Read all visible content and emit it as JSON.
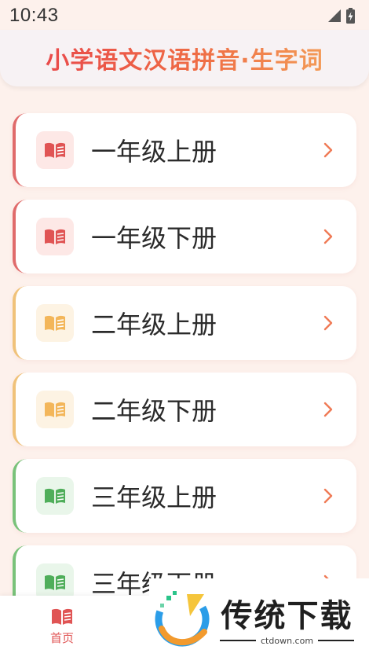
{
  "status_bar": {
    "time": "10:43"
  },
  "header": {
    "title": "小学语文汉语拼音·生字词"
  },
  "list": {
    "items": [
      {
        "label": "一年级上册",
        "accent": "#e06b6b",
        "icon_bg": "#fde8e6",
        "icon_color": "#e05454"
      },
      {
        "label": "一年级下册",
        "accent": "#e06b6b",
        "icon_bg": "#fde8e6",
        "icon_color": "#e05454"
      },
      {
        "label": "二年级上册",
        "accent": "#f0c27a",
        "icon_bg": "#fdf3e3",
        "icon_color": "#f3b65a"
      },
      {
        "label": "二年级下册",
        "accent": "#f0c27a",
        "icon_bg": "#fdf3e3",
        "icon_color": "#f3b65a"
      },
      {
        "label": "三年级上册",
        "accent": "#79c27a",
        "icon_bg": "#e9f6ea",
        "icon_color": "#4fae5a"
      },
      {
        "label": "三年级下册",
        "accent": "#79c27a",
        "icon_bg": "#e9f6ea",
        "icon_color": "#4fae5a"
      }
    ]
  },
  "bottom_nav": {
    "home_label": "首页",
    "active_color": "#e05454"
  },
  "watermark": {
    "main": "传统下载",
    "sub": "ctdown.com"
  }
}
